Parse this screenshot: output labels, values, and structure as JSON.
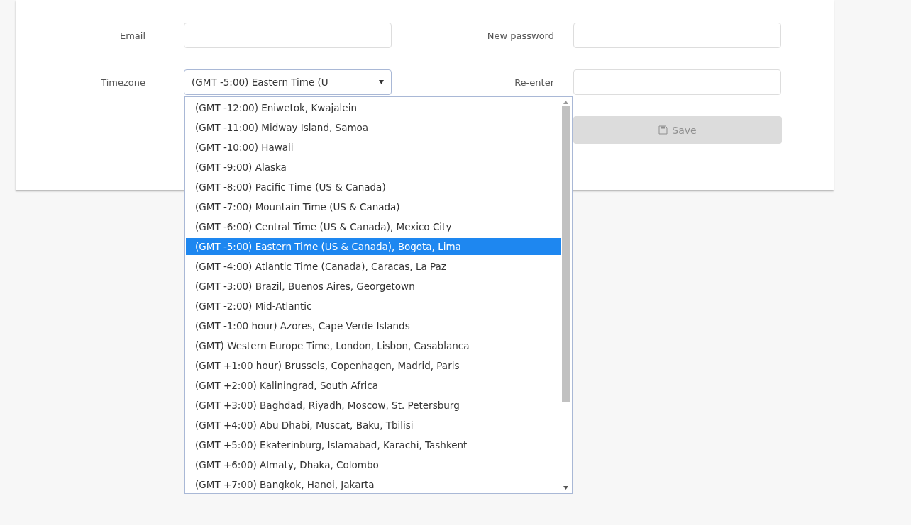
{
  "form": {
    "email": {
      "label": "Email"
    },
    "timezone": {
      "label": "Timezone",
      "value": "(GMT -5:00) Eastern Time (U",
      "expanded": true,
      "options": [
        {
          "label": "(GMT -12:00) Eniwetok, Kwajalein",
          "selected": false
        },
        {
          "label": "(GMT -11:00) Midway Island, Samoa",
          "selected": false
        },
        {
          "label": "(GMT -10:00) Hawaii",
          "selected": false
        },
        {
          "label": "(GMT -9:00) Alaska",
          "selected": false
        },
        {
          "label": "(GMT -8:00) Pacific Time (US & Canada)",
          "selected": false
        },
        {
          "label": "(GMT -7:00) Mountain Time (US & Canada)",
          "selected": false
        },
        {
          "label": "(GMT -6:00) Central Time (US & Canada), Mexico City",
          "selected": false
        },
        {
          "label": "(GMT -5:00) Eastern Time (US & Canada), Bogota, Lima",
          "selected": true
        },
        {
          "label": "(GMT -4:00) Atlantic Time (Canada), Caracas, La Paz",
          "selected": false
        },
        {
          "label": "(GMT -3:00) Brazil, Buenos Aires, Georgetown",
          "selected": false
        },
        {
          "label": "(GMT -2:00) Mid-Atlantic",
          "selected": false
        },
        {
          "label": "(GMT -1:00 hour) Azores, Cape Verde Islands",
          "selected": false
        },
        {
          "label": "(GMT) Western Europe Time, London, Lisbon, Casablanca",
          "selected": false
        },
        {
          "label": "(GMT +1:00 hour) Brussels, Copenhagen, Madrid, Paris",
          "selected": false
        },
        {
          "label": "(GMT +2:00) Kaliningrad, South Africa",
          "selected": false
        },
        {
          "label": "(GMT +3:00) Baghdad, Riyadh, Moscow, St. Petersburg",
          "selected": false
        },
        {
          "label": "(GMT +4:00) Abu Dhabi, Muscat, Baku, Tbilisi",
          "selected": false
        },
        {
          "label": "(GMT +5:00) Ekaterinburg, Islamabad, Karachi, Tashkent",
          "selected": false
        },
        {
          "label": "(GMT +6:00) Almaty, Dhaka, Colombo",
          "selected": false
        },
        {
          "label": "(GMT +7:00) Bangkok, Hanoi, Jakarta",
          "selected": false
        }
      ]
    },
    "new_password": {
      "label": "New password"
    },
    "reenter": {
      "label": "Re-enter"
    },
    "save_button": {
      "label": "Save",
      "disabled": true
    }
  }
}
